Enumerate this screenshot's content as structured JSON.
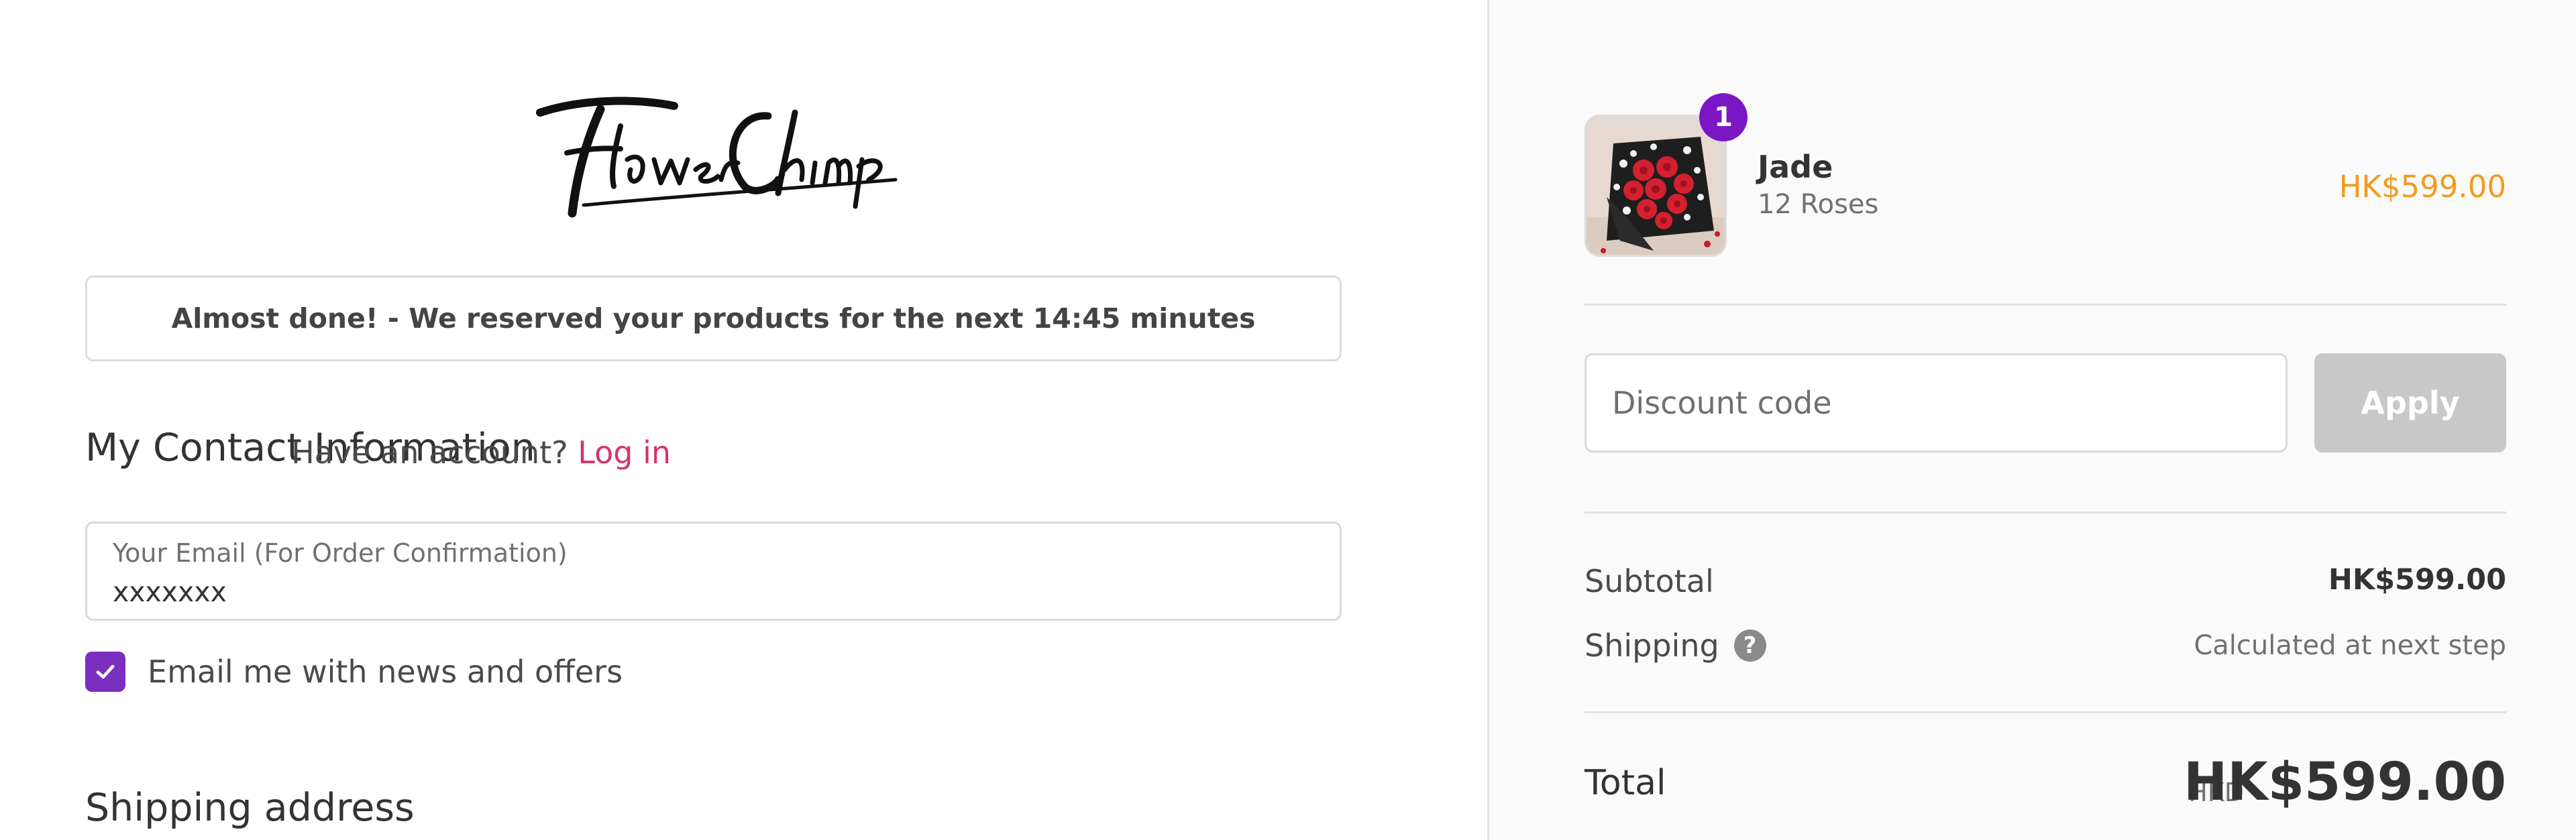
{
  "brand": {
    "logo_text": "FlowerChimp"
  },
  "banner": {
    "reserve_text": "Almost done! - We reserved your products for the next 14:45 minutes"
  },
  "contact": {
    "title": "My Contact Information",
    "account_prompt": "Have an account?",
    "login_label": "Log in",
    "email_label": "Your Email (For Order Confirmation)",
    "email_value": "xxxxxxx",
    "news_checkbox_label": "Email me with news and offers",
    "news_checked": true
  },
  "shipping": {
    "title": "Shipping address"
  },
  "order": {
    "items": [
      {
        "quantity": "1",
        "name": "Jade",
        "variant": "12 Roses",
        "price": "HK$599.00"
      }
    ],
    "discount_placeholder": "Discount code",
    "apply_label": "Apply",
    "subtotal_label": "Subtotal",
    "subtotal_value": "HK$599.00",
    "shipping_label": "Shipping",
    "shipping_value": "Calculated at next step",
    "total_label": "Total",
    "total_currency": "HKD",
    "total_value": "HK$599.00"
  },
  "colors": {
    "accent_purple": "#7b16c4",
    "login_link": "#d6336c",
    "price_orange": "#f39a1e",
    "apply_disabled": "#c8c8c8"
  },
  "icons": {
    "checkbox": "check-icon",
    "shipping_help": "question-circle-icon"
  }
}
